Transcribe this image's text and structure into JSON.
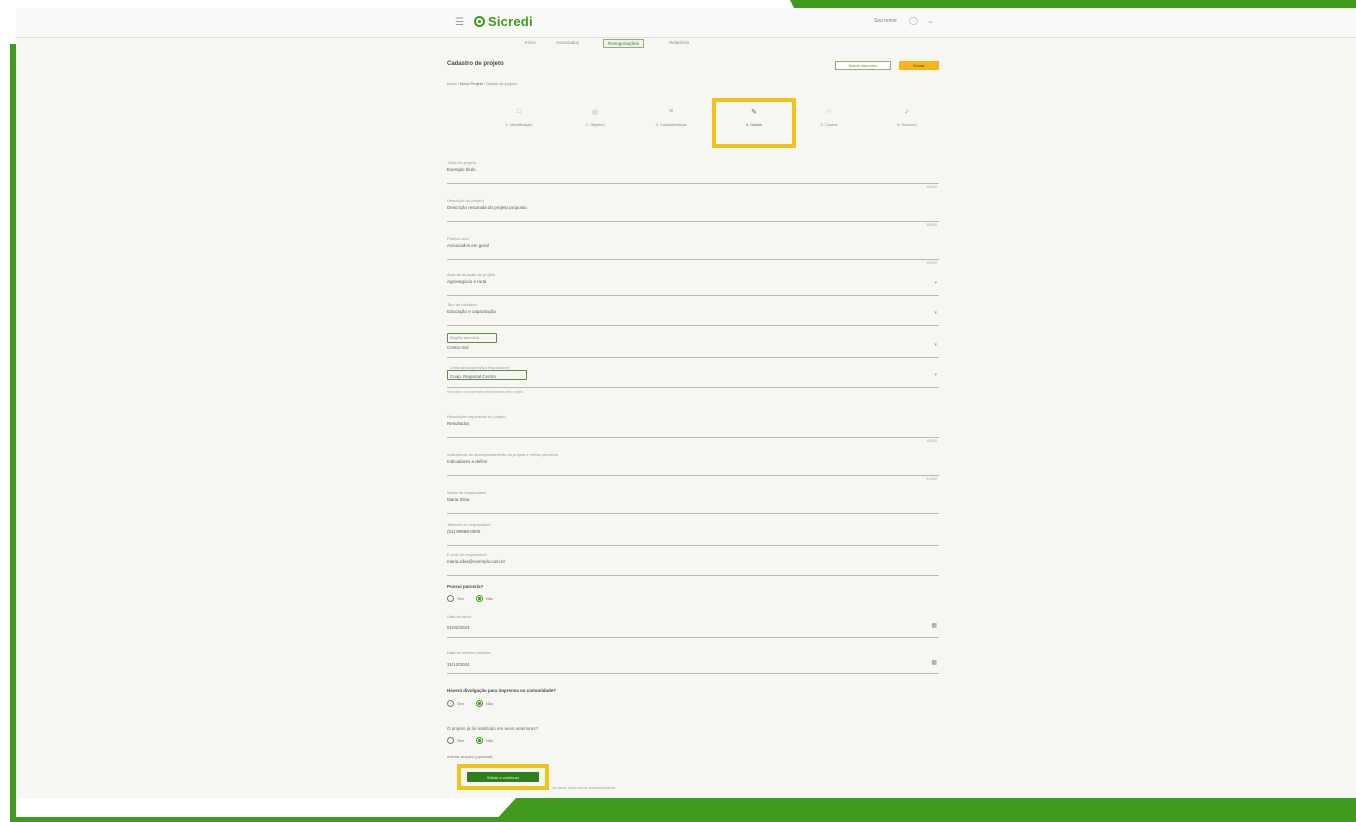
{
  "header": {
    "menu_icon": "menu-icon",
    "brand": "Sicredi",
    "user_name": "Seu nome",
    "user_icon": "user-icon"
  },
  "nav": {
    "items": [
      {
        "label": "Início"
      },
      {
        "label": "Associados"
      },
      {
        "label": "Renegociações"
      },
      {
        "label": "Relatórios"
      }
    ],
    "active_index": 2
  },
  "page": {
    "title": "Cadastro de projeto",
    "secondary_button": "Salvar rascunho",
    "primary_button": "Enviar",
    "breadcrumb": [
      "Início",
      "Novo Projeto",
      "Dados do projeto"
    ]
  },
  "steps": [
    {
      "label": "1. Identificação",
      "icon": "id-icon"
    },
    {
      "label": "2. Objetivo",
      "icon": "target-icon"
    },
    {
      "label": "3. Características",
      "icon": "list-icon"
    },
    {
      "label": "4. Dados",
      "icon": "pencil-icon"
    },
    {
      "label": "5. Custos",
      "icon": "coin-icon"
    },
    {
      "label": "6. Resumo",
      "icon": "check-icon"
    }
  ],
  "current_step": 3,
  "fields": [
    {
      "label": "Título do projeto",
      "value": "Exemplo título",
      "counter": "14/100",
      "type": "text"
    },
    {
      "label": "Descrição do projeto",
      "value": "Descrição resumida do projeto proposto",
      "counter": "38/500",
      "type": "text"
    },
    {
      "label": "Público-alvo",
      "value": "Associados em geral",
      "counter": "19/200",
      "type": "text"
    },
    {
      "label": "Área de atuação do projeto",
      "value": "Agronegócio e rural",
      "type": "select"
    },
    {
      "label": "Tipo de iniciativa",
      "value": "Educação e capacitação",
      "type": "select"
    },
    {
      "label": "Região atendida",
      "value": "Centro-Sul",
      "type": "select-boxed"
    },
    {
      "label": "Unidade/cooperativa responsável",
      "value": "Coop. Regional Centro",
      "hint": "Selecione a cooperativa responsável pelo projeto",
      "type": "select-boxed"
    },
    {
      "label": "Resultados esperados do projeto",
      "value": "Resultados",
      "counter": "10/300",
      "type": "text"
    },
    {
      "label": "Indicadores de acompanhamento do projeto e metas previstas",
      "value": "Indicadores a definir",
      "counter": "21/300",
      "type": "text"
    },
    {
      "label": "Nome do responsável",
      "value": "Maria Silva",
      "type": "text"
    },
    {
      "label": "Telefone do responsável",
      "value": "(51) 99999-0000",
      "type": "text"
    },
    {
      "label": "E-mail do responsável",
      "value": "maria.silva@exemplo.com.br",
      "type": "text"
    }
  ],
  "section_1": {
    "title": "Possui parceria?",
    "options": [
      "Sim",
      "Não"
    ],
    "selected": 1
  },
  "date_fields": [
    {
      "label": "Data de início",
      "value": "01/02/2024",
      "icon": "calendar-icon"
    },
    {
      "label": "Data de término prevista",
      "value": "31/12/2024",
      "icon": "calendar-icon"
    }
  ],
  "section_2": {
    "title": "Haverá divulgação para imprensa ou comunidade?",
    "options": [
      "Sim",
      "Não"
    ],
    "selected": 1
  },
  "section_3": {
    "title": "O projeto já foi realizado em anos anteriores?",
    "options": [
      "Sim",
      "Não"
    ],
    "selected": 1
  },
  "bottom_label": "Anexar arquivo (opcional)",
  "submit": {
    "label": "Salvar e continuar",
    "note": "Os dados serão salvos automaticamente"
  }
}
